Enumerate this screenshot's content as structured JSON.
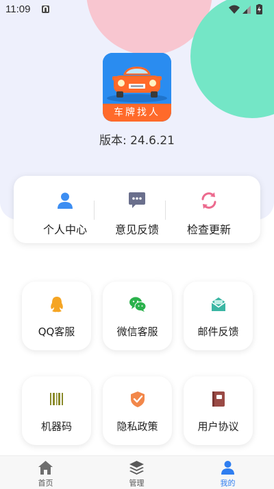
{
  "status_bar": {
    "time": "11:09"
  },
  "app": {
    "icon_text": "车牌找人",
    "version": "版本: 24.6.21"
  },
  "top_actions": [
    {
      "label": "个人中心",
      "icon": "user-icon"
    },
    {
      "label": "意见反馈",
      "icon": "feedback-icon"
    },
    {
      "label": "检查更新",
      "icon": "refresh-icon"
    }
  ],
  "services": [
    {
      "label": "QQ客服",
      "icon": "qq-icon"
    },
    {
      "label": "微信客服",
      "icon": "wechat-icon"
    },
    {
      "label": "邮件反馈",
      "icon": "mail-icon"
    },
    {
      "label": "机器码",
      "icon": "barcode-icon"
    },
    {
      "label": "隐私政策",
      "icon": "shield-icon"
    },
    {
      "label": "用户协议",
      "icon": "book-icon"
    }
  ],
  "tabbar": {
    "home": "首页",
    "manage": "管理",
    "mine": "我的",
    "active": "mine"
  },
  "colors": {
    "hero_bg": "#eef0fc",
    "blob_pink": "#f8c6d0",
    "blob_mint": "#74e6c6",
    "accent": "#2f7ef0",
    "app_icon_blue": "#2a8cf0",
    "app_icon_orange": "#ff6a2a"
  }
}
